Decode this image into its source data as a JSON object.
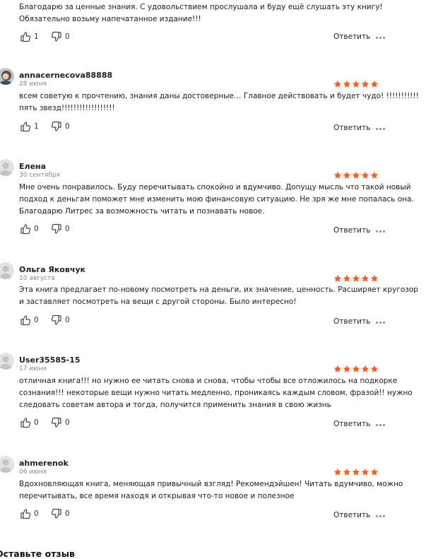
{
  "ui": {
    "reply_label": "Ответить",
    "star_color": "#ff5a1f",
    "leave_review_title": "Оставьте отзыв"
  },
  "reviews": [
    {
      "author": "",
      "date": "",
      "stars": 0,
      "text_lines": [
        "Благодарю за ценные знания. С удовольствием прослушала и буду ещё слушать эту книгу!",
        "Обязательно возьму напечатанное издание!!!"
      ],
      "likes": "1",
      "dislikes": "0",
      "avatar": "none"
    },
    {
      "author": "annacernecova88888",
      "date": "28 июня",
      "stars": 5,
      "text_lines": [
        "всем советую к прочтению, знания даны достоверные… Главное действовать и будет чудо! !!!!!!!!!!!",
        "пять звезд!!!!!!!!!!!!!!!!!!"
      ],
      "likes": "1",
      "dislikes": "0",
      "avatar": "photo"
    },
    {
      "author": "Елена",
      "date": "30 сентября",
      "stars": 5,
      "text_lines": [
        "Мне очень понравилось. Буду перечитывать спокойно и вдумчиво. Допущу мысль что такой новый",
        "подход к деньгам поможет мне изменить мою финансовую ситуацию. Не зря же мне попалась она.",
        "Благодарю Литрес за возможность читать и познавать новое."
      ],
      "likes": "0",
      "dislikes": "0",
      "avatar": "default"
    },
    {
      "author": "Ольга Яковчук",
      "date": "10 августа",
      "stars": 5,
      "text_lines": [
        "Эта книга предлагает по-новому посмотреть на деньги, их значение, ценность. Расширяет кругозор",
        "и заставляет посмотреть на вещи с другой стороны. Было интересно!"
      ],
      "likes": "0",
      "dislikes": "0",
      "avatar": "default"
    },
    {
      "author": "User35585-15",
      "date": "17 июня",
      "stars": 5,
      "text_lines": [
        "отличная книга!!! но нужно ее читать снова и снова, чтобы чтобы все отложилось на подкорке",
        "сознания!!! некоторые вещи нужно читать медленно, проникаясь каждым словом, фразой!! нужно",
        "следовать советам автора и тогда, получится применить знания в свою жизнь"
      ],
      "likes": "0",
      "dislikes": "0",
      "avatar": "default"
    },
    {
      "author": "ahmerenok",
      "date": "06 июня",
      "stars": 5,
      "text_lines": [
        "Вдохновляющая книга, меняющая привычный взгляд! Рекомендэйшен! Читать вдумчиво, можно",
        "перечитывать, все время находя и открывая что-то новое и полезное"
      ],
      "likes": "0",
      "dislikes": "0",
      "avatar": "default"
    }
  ]
}
